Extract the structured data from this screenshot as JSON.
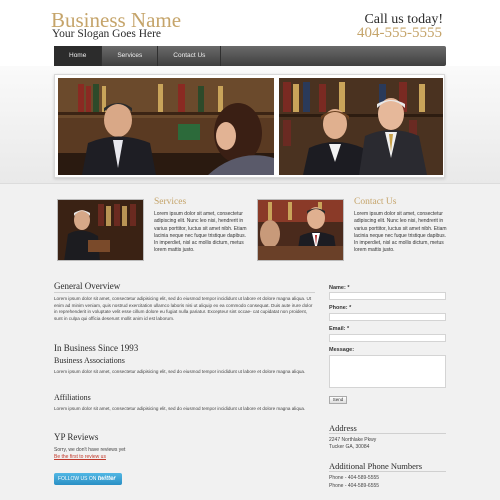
{
  "header": {
    "business_name": "Business Name",
    "slogan": "Your Slogan Goes Here",
    "call_label": "Call us today!",
    "call_number": "404-555-5555"
  },
  "nav": {
    "items": [
      {
        "label": "Home",
        "active": true
      },
      {
        "label": "Services",
        "active": false
      },
      {
        "label": "Contact Us",
        "active": false
      }
    ]
  },
  "features": {
    "services": {
      "title": "Services",
      "text": "Lorem ipsum dolor sit amet, consectetur adipiscing elit. Nunc leo nisi, hendrerit in varius porttitor, luctus sit amet nibh. Etiam lacinia neque nec fuque tristique dapibus. In imperdiet, nisl ac mollis dictum, metus lorem mattis justo."
    },
    "contact": {
      "title": "Contact Us",
      "text": "Lorem ipsum dolor sit amet, consectetur adipiscing elit. Nunc leo nisi, hendrerit in varius porttitor, luctus sit amet nibh. Etiam lacinia neque nec fuque tristique dapibus. In imperdiet, nisl ac mollis dictum, metus lorem mattis justo."
    }
  },
  "main": {
    "general_title": "General Overview",
    "general_text": "Lorem ipsum dolor sit amet, consectetur adipisicing elit, sed do eiusmod tempor incididunt ut labore et dolore magna aliqua. Ut enim ad minim veniam, quis nostrud exercitation ullamco laboris nisi ut aliquip ex ea commodo consequat. Duis aute irure dolor in reprehenderit in voluptate velit esse cillum dolore eu fugiat nulla pariatur. Excepteur sint occae- cat cupidatat non proident, sunt in culpa qui officia deserunt mollit anim id est laborum.",
    "since_title": "In Business Since 1993",
    "assoc_title": "Business Associations",
    "assoc_text": "Lorem ipsum dolor sit amet, consectetur adipisicing elit, sed do eiusmod tempor incididunt ut labore et dolore magna aliqua.",
    "affil_title": "Affiliations",
    "affil_text": "Lorem ipsum dolor sit amet, consectetur adipisicing elit, sed do eiusmod tempor incididunt ut labore et dolore magna aliqua.",
    "yp_title": "YP Reviews",
    "yp_text": "Sorry, we don't have reviews yet",
    "yp_link": "Be the first to review us",
    "twitter_prefix": "FOLLOW US ON",
    "twitter_brand": "twitter"
  },
  "form": {
    "name_label": "Name: *",
    "phone_label": "Phone: *",
    "email_label": "Email: *",
    "message_label": "Message:",
    "send_label": "Send"
  },
  "sidebar": {
    "address_title": "Address",
    "address_line1": "2247 Northlake Pkwy",
    "address_line2": "Tucker GA, 30084",
    "phones_title": "Additional Phone Numbers",
    "phone1": "Phone - 404-589-5555",
    "phone2": "Phone - 404-589-6555"
  },
  "colors": {
    "accent": "#c5a46a",
    "nav_bg": "#4a4a4a",
    "link": "#c0392b",
    "twitter": "#3aa0d4"
  }
}
